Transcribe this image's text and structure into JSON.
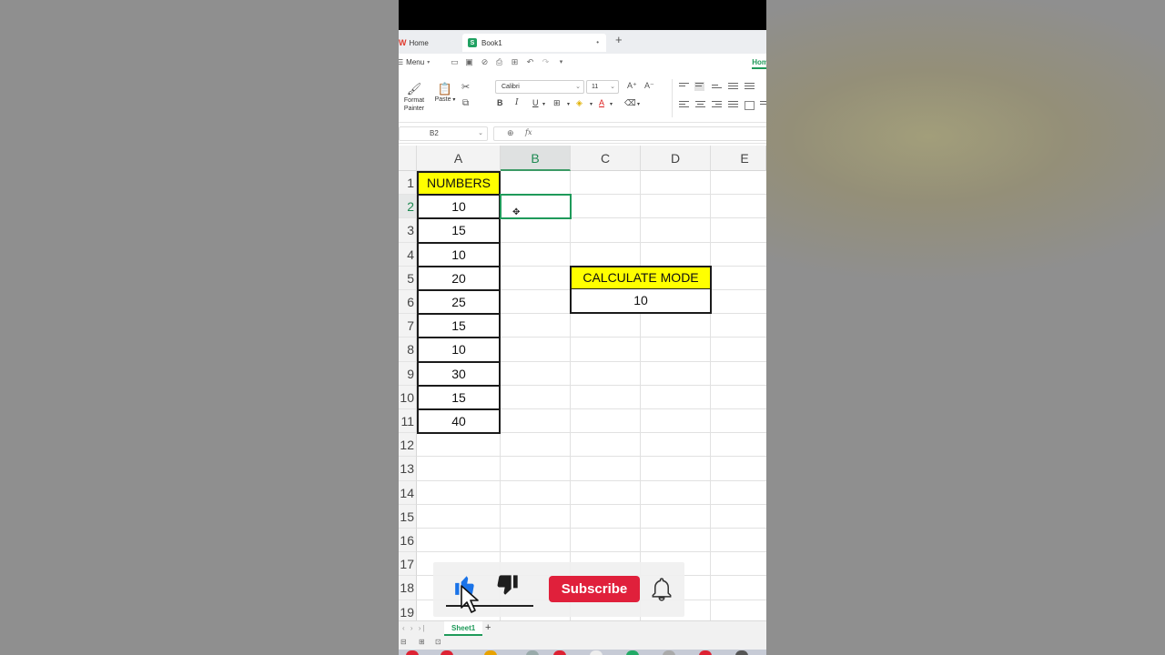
{
  "tabs": {
    "home_label": "Home",
    "book_label": "Book1",
    "book_dot": "•",
    "new_tab": "+"
  },
  "menubar": {
    "menu_label": "Menu",
    "home_tab": "Hom"
  },
  "ribbon": {
    "format_painter": "Format Painter",
    "format_painter_l1": "Format",
    "format_painter_l2": "Painter",
    "paste": "Paste",
    "font_name": "Calibri",
    "font_size": "11",
    "bold": "B",
    "italic": "I",
    "underline": "U",
    "font_color_letter": "A"
  },
  "formula_bar": {
    "name_box": "B2",
    "fx_label": "fx",
    "formula_value": ""
  },
  "grid": {
    "columns": [
      "A",
      "B",
      "C",
      "D",
      "E"
    ],
    "selected_column": "B",
    "rows": [
      "1",
      "2",
      "3",
      "4",
      "5",
      "6",
      "7",
      "8",
      "9",
      "10",
      "11",
      "12",
      "13",
      "14",
      "15",
      "16",
      "17",
      "18",
      "19"
    ],
    "selected_row": "2",
    "a1_header": "NUMBERS",
    "numbers": [
      "10",
      "15",
      "10",
      "20",
      "25",
      "15",
      "10",
      "30",
      "15",
      "40"
    ],
    "mode_header": "CALCULATE MODE",
    "mode_result": "10",
    "active_cell": "B2"
  },
  "sheets": {
    "active_sheet": "Sheet1",
    "add": "+"
  },
  "overlay": {
    "subscribe_label": "Subscribe",
    "like_icon": "thumbs-up-icon",
    "dislike_icon": "thumbs-down-icon",
    "bell_icon": "bell-icon"
  },
  "colors": {
    "header_fill": "#ffff00",
    "active_cell_border": "#1f9a5a",
    "subscribe_red": "#e0203b",
    "like_blue": "#1a73e8"
  }
}
